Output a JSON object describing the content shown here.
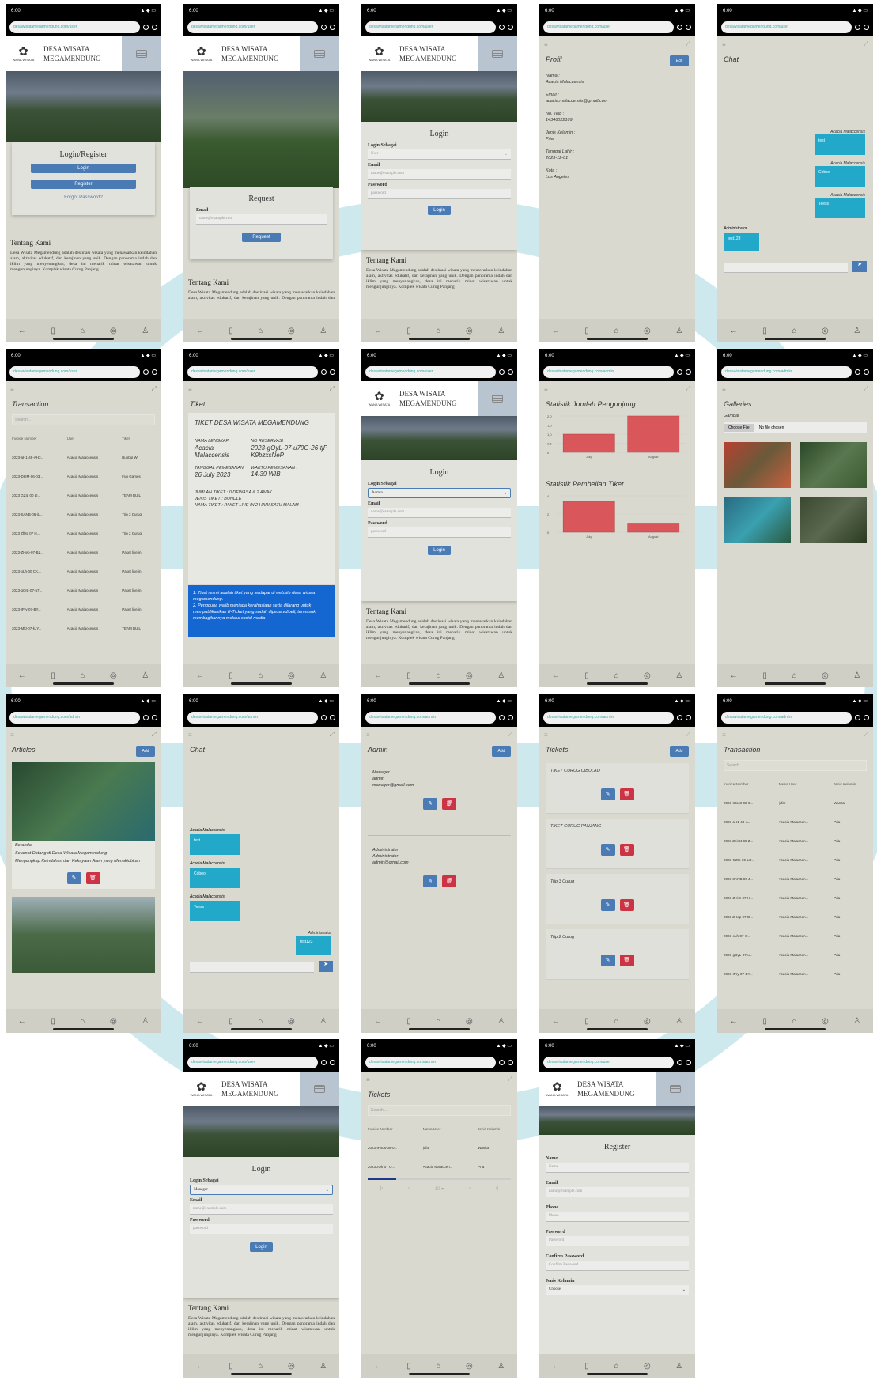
{
  "common": {
    "time": "6:00",
    "url_user": "desawisatamegamendung.com/user",
    "url_admin": "desawisatamegamendung.com/admin",
    "brand_line1": "DESA WISATA",
    "brand_line2": "MEGAMENDUNG",
    "logo_text": "WANA WISATA",
    "about_title": "Tentang Kami",
    "about_text": "Desa Wisata Megamendung adalah destinasi wisata yang menawarkan keindahan alam, aktivitas edukatif, dan kerajinan yang unik. Dengan panorama indah dan iklim yang menyenangkan, desa ini menarik minat wisatawan untuk mengunjunginya. Komplek wisata Curug Panjang"
  },
  "p1": {
    "title": "Login/Register",
    "login": "Login",
    "register": "Register",
    "forgot": "Forgot Password?"
  },
  "p2": {
    "title": "Request",
    "email_label": "Email",
    "email_ph": "name@example.com",
    "btn": "Request"
  },
  "p3": {
    "title": "Login",
    "login_as": "Login Sebagai",
    "role": "User",
    "email": "Email",
    "email_ph": "name@example.com",
    "password": "Password",
    "password_ph": "password",
    "btn": "Login"
  },
  "p4": {
    "title": "Profil",
    "edit": "Edit",
    "name_l": "Nama :",
    "name": "Acacia Malaccensis",
    "email_l": "Email :",
    "email": "acacia.malaccensis@gmail.com",
    "phone_l": "No. Telp :",
    "phone": "14346022109",
    "gender_l": "Jenis Kelamin :",
    "gender": "Pria",
    "dob_l": "Tanggal Lahir :",
    "dob": "2023-12-01",
    "city_l": "Kota :",
    "city": "Los Angeles"
  },
  "p5": {
    "title": "Chat",
    "messages": [
      {
        "name": "Acacia Malaccensis",
        "text": "test"
      },
      {
        "name": "Acacia Malaccensis",
        "text": "Coboo"
      },
      {
        "name": "Acacia Malaccensis",
        "text": "Teess"
      }
    ],
    "admin_name": "Administrator",
    "admin_text": "test123"
  },
  "p6": {
    "title": "Transaction",
    "search": "Search...",
    "headers": [
      "Invoice Number",
      "User",
      "Tiket"
    ],
    "rows": [
      [
        "2023-aH1-48-AH3...",
        "Acacia Malaccensis",
        "Bunbul Wi"
      ],
      [
        "2023-D6IM-06-03...",
        "Acacia Malaccensis",
        "Fun Games"
      ],
      [
        "2023 GZIp 00 LI...",
        "Acacia Malaccensis",
        "TEAM BUIL"
      ],
      [
        "2023-SANB-06-jU...",
        "Acacia Malaccensis",
        "Trip 3 Curug"
      ],
      [
        "2023 ZfHL 07 H...",
        "Acacia Malaccensis",
        "Trip 2 Curug"
      ],
      [
        "2023-ZHep-07-BZ...",
        "Acacia Malaccensis",
        "Paket live in"
      ],
      [
        "2023-oLh-00 CK...",
        "Acacia Malaccensis",
        "Paket live in"
      ],
      [
        "2023-qOrL-07-u7...",
        "Acacia Malaccensis",
        "Paket live in"
      ],
      [
        "2023-IPry-07-BY...",
        "Acacia Malaccensis",
        "Paket live in"
      ],
      [
        "2023-MfJ-07-kJY...",
        "Acacia Malaccensis",
        "TEAM BUIL"
      ]
    ]
  },
  "p7": {
    "title": "Tiket",
    "ticket_title": "TIKET DESA WISATA MEGAMENDUNG",
    "nama_l": "NAMA LENGKAP:",
    "nama": "Acacia Malaccensis",
    "res_l": "NO RESERVASI :",
    "res": "2023-gOyL-07-u79G-26-tjPK9bzxsNeP",
    "tgl_l": "TANGGAL PEMESANAN",
    "tgl": "26 July 2023",
    "wkt_l": "WAKTU PEMESANAN :",
    "wkt": "14:39 WIB",
    "jumlah": "JUMLAH TIKET : 0 DEWASA & 2 ANAK",
    "jenis": "JENIS TIKET : BUNDLE",
    "nama_tiket": "NAMA TIKET : PAKET LIVE IN 2 HARI SATU MALAM",
    "notes": [
      "Tiket resmi adalah tiket yang terdapat di website desa wisata megamendung.",
      "Pengguna wajib menjaga kerahasiaan serta dilarang untuk mempublikasikan E-Ticket yang sudah dipesan/dibeli, termasuk membagikannya melalui sosial media"
    ]
  },
  "p8": {
    "title": "Login",
    "login_as": "Login Sebagai",
    "role": "Admin",
    "email": "Email",
    "email_ph": "name@example.com",
    "password": "Password",
    "password_ph": "password",
    "btn": "Login"
  },
  "p9": {
    "title1": "Statistik Jumlah Pengunjung",
    "title2": "Statistik Pembelian Tiket"
  },
  "chart_data": [
    {
      "type": "bar",
      "categories": [
        "July",
        "August"
      ],
      "values": [
        1.0,
        2.0
      ],
      "title": "Statistik Jumlah Pengunjung",
      "ylim": [
        0,
        2.0
      ],
      "ticks": [
        "2,0",
        "1,5",
        "1,0",
        "0,5",
        "0"
      ]
    },
    {
      "type": "bar",
      "categories": [
        "July",
        "August"
      ],
      "values": [
        3.4,
        1.0
      ],
      "title": "Statistik Pembelian Tiket",
      "ylim": [
        0,
        4
      ],
      "ticks": [
        "4",
        "2",
        "0"
      ]
    }
  ],
  "p10": {
    "title": "Galleries",
    "gambar": "Gambar",
    "choose": "Choose File",
    "nofile": "No file chosen"
  },
  "p11": {
    "title": "Articles",
    "add": "Add",
    "a1_label": "Beranda",
    "a1_title": "Selamat Datang di Desa Wisata Megamendung",
    "a1_sub": "Mengungkap Keindahan dan Kekayaan Alam yang Menakjubkan"
  },
  "p12": {
    "title": "Chat",
    "messages": [
      {
        "name": "Acacia Malaccensis",
        "text": "test"
      },
      {
        "name": "Acacia Malaccensis",
        "text": "Coboo"
      },
      {
        "name": "Acacia Malaccensis",
        "text": "Teess"
      }
    ],
    "admin_name": "Administrator",
    "admin_text": "test123"
  },
  "p13": {
    "title": "Admin",
    "add": "Add",
    "admins": [
      {
        "role": "Manager",
        "name": "admin",
        "email": "manager@gmail.com"
      },
      {
        "role": "Administrator",
        "name": "Administrator",
        "email": "admin@gmail.com"
      }
    ]
  },
  "p14": {
    "title": "Tickets",
    "add": "Add",
    "tickets": [
      "TIKET CURUG CIBULAO",
      "TIKET CURUG PANJANG",
      "Trip 3 Curug",
      "Trip 2 Curug"
    ]
  },
  "p15": {
    "title": "Transaction",
    "search": "Search...",
    "headers": [
      "Invoice Number",
      "Nama User",
      "Jenis Kelamin"
    ],
    "rows": [
      [
        "2023-IHsc8-08-0...",
        "jufar",
        "Wanita"
      ],
      [
        "2023-aH1-48-A...",
        "Acacia Malaccen...",
        "Pria"
      ],
      [
        "2023 ZeiH4 08 Z...",
        "Acacia Malaccen...",
        "Pria"
      ],
      [
        "2023-GZIp-06-LO...",
        "Acacia Malaccen...",
        "Pria"
      ],
      [
        "2023 SANB 06 J...",
        "Acacia Malaccen...",
        "Pria"
      ],
      [
        "2023-ZHiG-07-H...",
        "Acacia Malaccen...",
        "Pria"
      ],
      [
        "2023 ZHep 07 O...",
        "Acacia Malaccen...",
        "Pria"
      ],
      [
        "2023-oLh-07-O...",
        "Acacia Malaccen...",
        "Pria"
      ],
      [
        "2023-gOyL-07-u...",
        "Acacia Malaccen...",
        "Pria"
      ],
      [
        "2023-IPry-07-BY...",
        "Acacia Malaccen...",
        "Pria"
      ]
    ]
  },
  "p16": {
    "title": "Login",
    "login_as": "Login Sebagai",
    "role": "Manager",
    "email": "Email",
    "email_ph": "name@example.com",
    "password": "Password",
    "password_ph": "password",
    "btn": "Login"
  },
  "p17": {
    "title": "Tickets",
    "search": "Search...",
    "headers": [
      "Invoice Number",
      "Nama User",
      "Jenis Kelamin"
    ],
    "rows": [
      [
        "2023-IHsc8-08-0...",
        "jufar",
        "Wanita"
      ],
      [
        "2023 zOlr 07 O...",
        "Acacia Malaccen...",
        "Pria"
      ]
    ]
  },
  "p18": {
    "title": "Register",
    "name": "Name",
    "name_ph": "Name",
    "email": "Email",
    "email_ph": "name@example.com",
    "phone": "Phone",
    "phone_ph": "Phone",
    "password": "Password",
    "password_ph": "Password",
    "confirm": "Confirm Password",
    "confirm_ph": "Confirm Password",
    "gender": "Jenis Kelamin",
    "gender_val": "Choose"
  },
  "colors": {
    "accent": "#4a7bb5",
    "chat": "#22a8c9",
    "bar": "#d9575a",
    "danger": "#cc3344"
  }
}
